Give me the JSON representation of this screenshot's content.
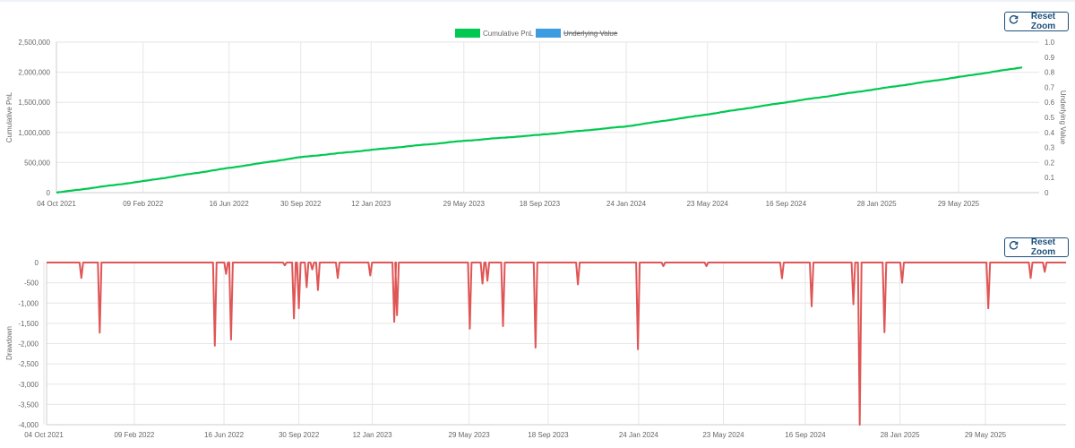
{
  "toolbar": {
    "reset_zoom_label": "Reset Zoom"
  },
  "icons": {
    "reset": "refresh-icon"
  },
  "colors": {
    "pnl": "#00c851",
    "underlying": "#3d9be0",
    "drawdown": "#e05555",
    "button": "#1d4f7c",
    "grid": "#e6e6e6"
  },
  "chart_data": [
    {
      "type": "line",
      "title": "",
      "ylabel": "Cumulative PnL",
      "y2label": "Underlying Value",
      "legend": [
        {
          "name": "Cumulative PnL",
          "color": "#00c851",
          "hidden": false
        },
        {
          "name": "Underlying Value",
          "color": "#3d9be0",
          "hidden": true
        }
      ],
      "legend_position": "top-center",
      "grid": true,
      "x_ticks": [
        "04 Oct 2021",
        "09 Feb 2022",
        "16 Jun 2022",
        "30 Sep 2022",
        "12 Jan 2023",
        "29 May 2023",
        "18 Sep 2023",
        "24 Jan 2024",
        "23 May 2024",
        "16 Sep 2024",
        "28 Jan 2025",
        "29 May 2025"
      ],
      "y_ticks": [
        "0",
        "500,000",
        "1,000,000",
        "1,500,000",
        "2,000,000",
        "2,500,000"
      ],
      "y2_ticks": [
        "0",
        "0.1",
        "0.2",
        "0.3",
        "0.4",
        "0.5",
        "0.6",
        "0.7",
        "0.8",
        "0.9",
        "1.0"
      ],
      "ylim": [
        0,
        2500000
      ],
      "y2lim": [
        0,
        1
      ],
      "series": [
        {
          "name": "Cumulative PnL",
          "x": [
            "04 Oct 2021",
            "09 Feb 2022",
            "16 Jun 2022",
            "30 Sep 2022",
            "12 Jan 2023",
            "29 May 2023",
            "18 Sep 2023",
            "24 Jan 2024",
            "23 May 2024",
            "16 Sep 2024",
            "28 Jan 2025",
            "29 May 2025",
            "31 Aug 2025"
          ],
          "values": [
            0,
            190000,
            410000,
            590000,
            710000,
            860000,
            960000,
            1100000,
            1300000,
            1500000,
            1720000,
            1920000,
            2080000
          ]
        }
      ]
    },
    {
      "type": "area",
      "title": "",
      "ylabel": "Drawdown",
      "legend": [],
      "grid": true,
      "x_ticks": [
        "04 Oct 2021",
        "09 Feb 2022",
        "16 Jun 2022",
        "30 Sep 2022",
        "12 Jan 2023",
        "29 May 2023",
        "18 Sep 2023",
        "24 Jan 2024",
        "23 May 2024",
        "16 Sep 2024",
        "28 Jan 2025",
        "29 May 2025"
      ],
      "y_ticks": [
        "0",
        "-500",
        "-1,000",
        "-1,500",
        "-2,000",
        "-2,500",
        "-3,000",
        "-3,500",
        "-4,000"
      ],
      "ylim": [
        -4000,
        0
      ],
      "series": [
        {
          "name": "Drawdown",
          "dips": [
            {
              "date": "2021-11-26",
              "value": -380
            },
            {
              "date": "2021-12-22",
              "value": -1730
            },
            {
              "date": "2022-06-03",
              "value": -2050
            },
            {
              "date": "2022-06-19",
              "value": -280
            },
            {
              "date": "2022-06-26",
              "value": -1900
            },
            {
              "date": "2022-09-10",
              "value": -70
            },
            {
              "date": "2022-09-23",
              "value": -1380
            },
            {
              "date": "2022-09-30",
              "value": -1130
            },
            {
              "date": "2022-10-11",
              "value": -610
            },
            {
              "date": "2022-10-19",
              "value": -170
            },
            {
              "date": "2022-10-27",
              "value": -680
            },
            {
              "date": "2022-11-24",
              "value": -380
            },
            {
              "date": "2023-01-09",
              "value": -320
            },
            {
              "date": "2023-02-12",
              "value": -1460
            },
            {
              "date": "2023-02-16",
              "value": -1300
            },
            {
              "date": "2023-05-30",
              "value": -1630
            },
            {
              "date": "2023-06-17",
              "value": -520
            },
            {
              "date": "2023-06-24",
              "value": -450
            },
            {
              "date": "2023-07-16",
              "value": -1570
            },
            {
              "date": "2023-08-31",
              "value": -2100
            },
            {
              "date": "2023-10-30",
              "value": -540
            },
            {
              "date": "2024-01-23",
              "value": -2140
            },
            {
              "date": "2024-02-28",
              "value": -90
            },
            {
              "date": "2024-04-29",
              "value": -90
            },
            {
              "date": "2024-08-14",
              "value": -390
            },
            {
              "date": "2024-09-25",
              "value": -1080
            },
            {
              "date": "2024-11-23",
              "value": -1030
            },
            {
              "date": "2024-12-02",
              "value": -4000
            },
            {
              "date": "2025-01-06",
              "value": -1720
            },
            {
              "date": "2025-01-31",
              "value": -500
            },
            {
              "date": "2025-06-02",
              "value": -1130
            },
            {
              "date": "2025-08-01",
              "value": -380
            },
            {
              "date": "2025-08-21",
              "value": -230
            }
          ]
        }
      ]
    }
  ]
}
